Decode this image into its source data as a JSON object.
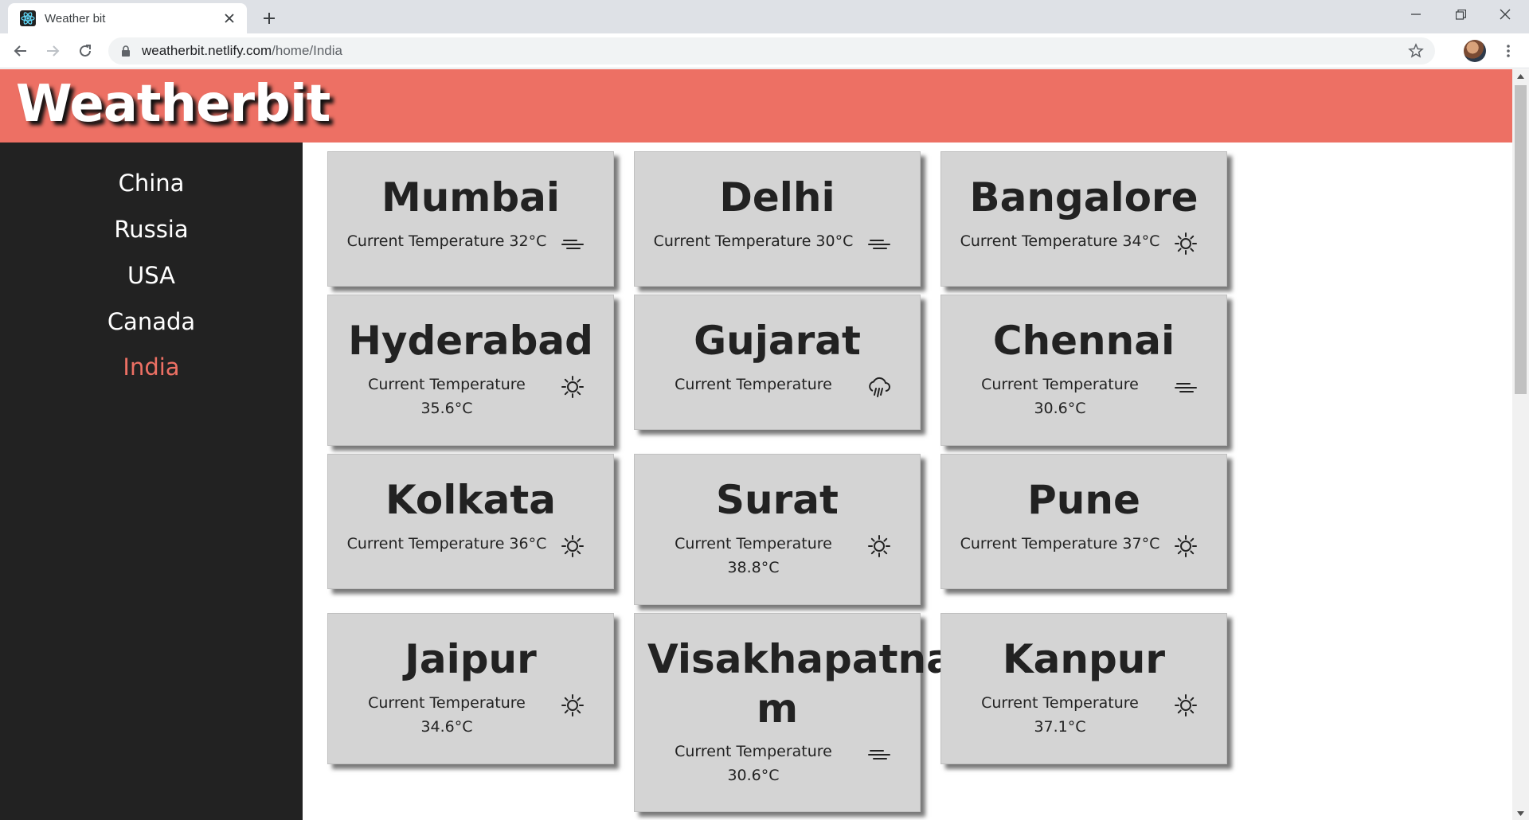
{
  "browser": {
    "tab_title": "Weather bit",
    "url_host": "weatherbit.netlify.com",
    "url_path": "/home/India"
  },
  "app": {
    "brand": "Weatherbit",
    "accent_color": "#ed7064",
    "sidebar_color": "#222222",
    "card_color": "#d4d4d4"
  },
  "sidebar": {
    "items": [
      {
        "label": "China",
        "active": false
      },
      {
        "label": "Russia",
        "active": false
      },
      {
        "label": "USA",
        "active": false
      },
      {
        "label": "Canada",
        "active": false
      },
      {
        "label": "India",
        "active": true
      }
    ]
  },
  "cards": [
    {
      "city": "Mumbai",
      "temp_line1": "Current Temperature 32°C",
      "temp_line2": "",
      "icon": "haze-icon"
    },
    {
      "city": "Delhi",
      "temp_line1": "Current Temperature 30°C",
      "temp_line2": "",
      "icon": "haze-icon"
    },
    {
      "city": "Bangalore",
      "temp_line1": "Current Temperature 34°C",
      "temp_line2": "",
      "icon": "sun-icon"
    },
    {
      "city": "Hyderabad",
      "temp_line1": "Current Temperature",
      "temp_line2": "35.6°C",
      "icon": "sun-icon"
    },
    {
      "city": "Gujarat",
      "temp_line1": "Current Temperature",
      "temp_line2": "",
      "icon": "rain-cloud-icon"
    },
    {
      "city": "Chennai",
      "temp_line1": "Current Temperature",
      "temp_line2": "30.6°C",
      "icon": "haze-icon"
    },
    {
      "city": "Kolkata",
      "temp_line1": "Current Temperature 36°C",
      "temp_line2": "",
      "icon": "sun-icon"
    },
    {
      "city": "Surat",
      "temp_line1": "Current Temperature",
      "temp_line2": "38.8°C",
      "icon": "sun-icon"
    },
    {
      "city": "Pune",
      "temp_line1": "Current Temperature 37°C",
      "temp_line2": "",
      "icon": "sun-icon"
    },
    {
      "city": "Jaipur",
      "temp_line1": "Current Temperature",
      "temp_line2": "34.6°C",
      "icon": "sun-icon"
    },
    {
      "city": "Visakhapatna\nm",
      "temp_line1": "Current Temperature",
      "temp_line2": "30.6°C",
      "icon": "haze-icon"
    },
    {
      "city": "Kanpur",
      "temp_line1": "Current Temperature",
      "temp_line2": "37.1°C",
      "icon": "sun-icon"
    }
  ]
}
